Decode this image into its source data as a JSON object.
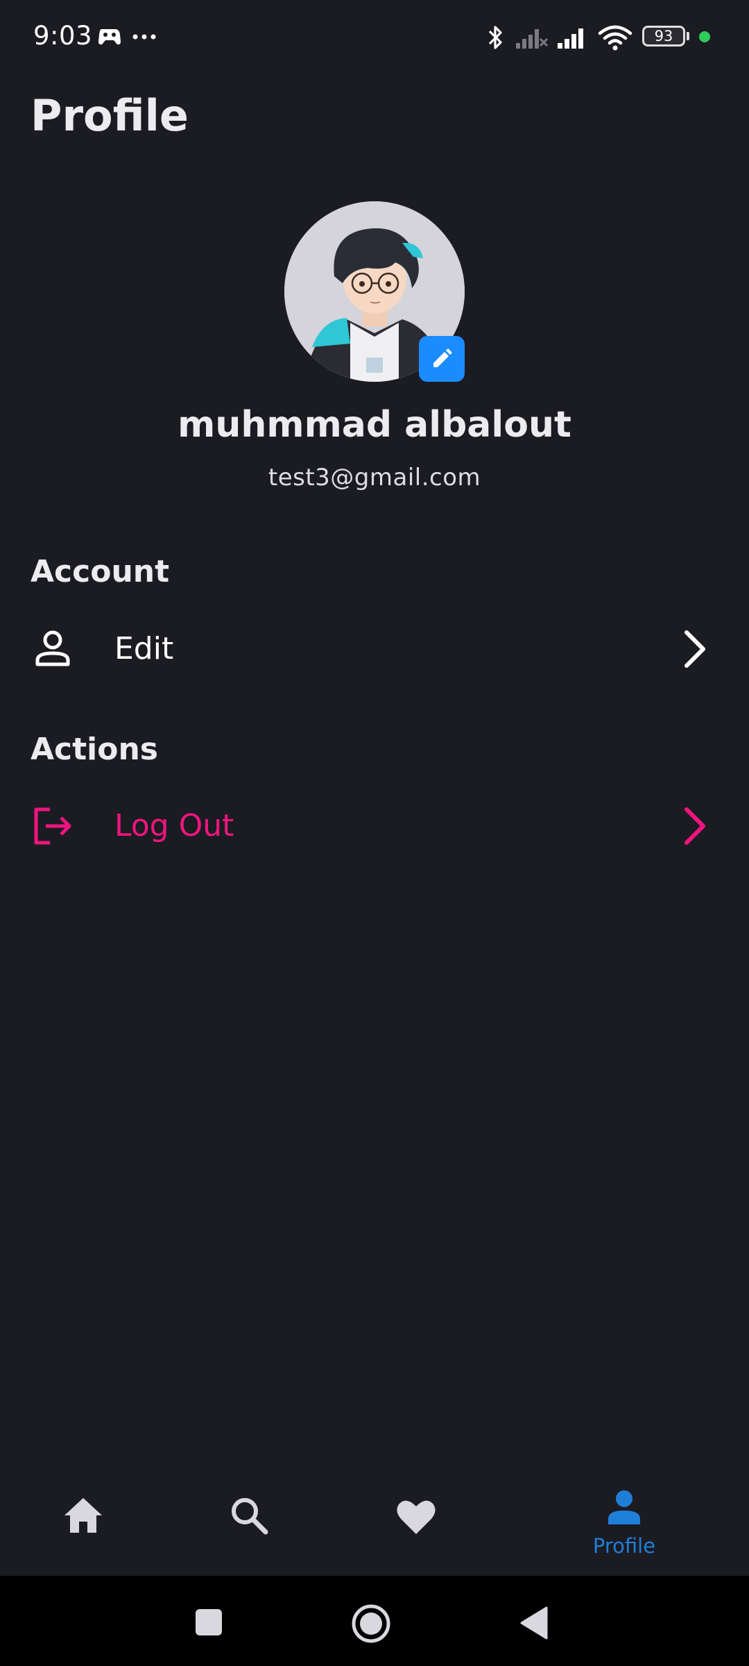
{
  "status_bar": {
    "time": "9:03",
    "battery_level": "93",
    "icons": [
      "game-controller-icon",
      "more-dots-icon",
      "bluetooth-icon",
      "signal-off-icon",
      "signal-icon",
      "wifi-icon",
      "battery-icon",
      "active-dot"
    ]
  },
  "header": {
    "title": "Profile"
  },
  "profile": {
    "name": "muhmmad albalout",
    "email": "test3@gmail.com",
    "avatar_icon": "avatar-illustration",
    "edit_icon": "pencil-icon"
  },
  "sections": {
    "account": {
      "title": "Account",
      "items": [
        {
          "label": "Edit",
          "icon": "person-icon",
          "color": "#ffffff"
        }
      ]
    },
    "actions": {
      "title": "Actions",
      "items": [
        {
          "label": "Log Out",
          "icon": "logout-icon",
          "color": "#f0157f"
        }
      ]
    }
  },
  "bottom_nav": {
    "items": [
      {
        "id": "home",
        "icon": "home-icon",
        "label": ""
      },
      {
        "id": "search",
        "icon": "search-icon",
        "label": ""
      },
      {
        "id": "favorites",
        "icon": "heart-icon",
        "label": ""
      },
      {
        "id": "profile",
        "icon": "profile-icon",
        "label": "Profile",
        "active": true
      }
    ],
    "active_color": "#1f7fd8",
    "inactive_color": "#d8d8de"
  },
  "system_nav": {
    "icons": [
      "recents-square-icon",
      "home-circle-icon",
      "back-triangle-icon"
    ]
  }
}
